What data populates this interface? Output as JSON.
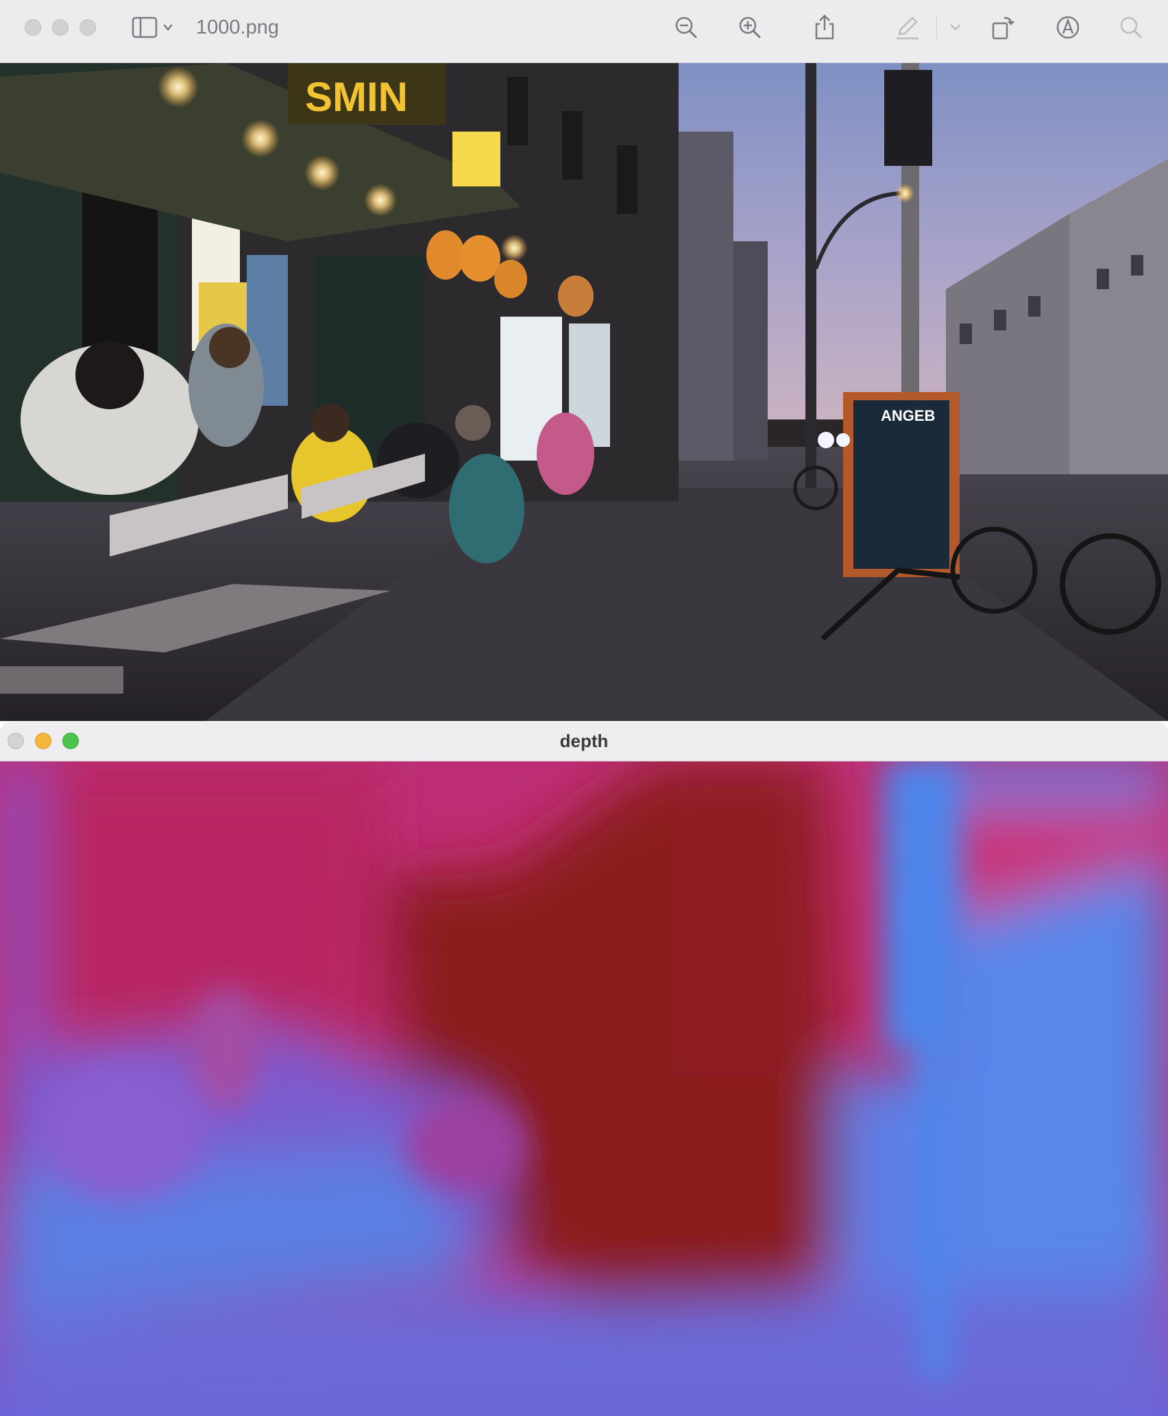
{
  "preview": {
    "title": "1000.png",
    "toolbar": {
      "sidebar": "sidebar-toggle-icon",
      "zoom_out": "zoom-out-icon",
      "zoom_in": "zoom-in-icon",
      "share": "share-icon",
      "markup": "pencil-icon",
      "rotate": "rotate-icon",
      "annotate": "markup-circle-icon",
      "search": "search-icon"
    }
  },
  "photo": {
    "sign_restaurant": "SMIN",
    "sign_board": "ANGEB"
  },
  "depth_window": {
    "title": "depth",
    "lights": {
      "close": "#d4d2d5",
      "minimize": "#f4b63a",
      "zoom": "#4dc54c"
    }
  },
  "colors": {
    "far": "#8a1a1c",
    "mid": "#cc2f7a",
    "near": "#5886ea"
  }
}
